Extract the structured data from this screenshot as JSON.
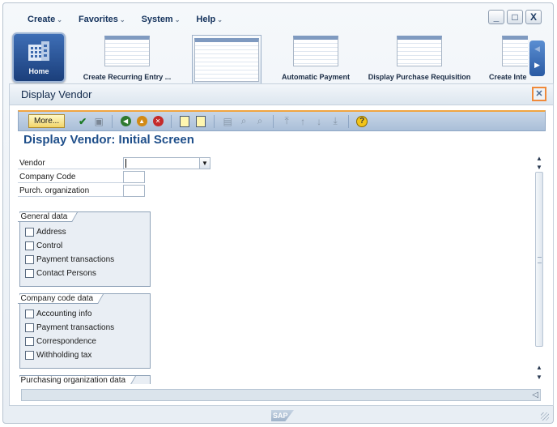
{
  "menu": [
    "Create",
    "Favorites",
    "System",
    "Help"
  ],
  "window_controls": {
    "minimize": "_",
    "maximize": "□",
    "close": "X"
  },
  "launchpad": {
    "home_label": "Home",
    "tiles": [
      "Create Recurring Entry ...",
      "",
      "Automatic Payment",
      "Display Purchase Requisition",
      "Create Inte"
    ]
  },
  "window": {
    "title": "Display Vendor",
    "close": "✕"
  },
  "toolbar": {
    "more_label": "More..."
  },
  "screen_title": "Display Vendor:  Initial Screen",
  "fields": {
    "vendor": {
      "label": "Vendor",
      "value": ""
    },
    "company_code": {
      "label": "Company Code",
      "value": ""
    },
    "purch_org": {
      "label": "Purch. organization",
      "value": ""
    }
  },
  "groups": {
    "general": {
      "title": "General data",
      "items": [
        "Address",
        "Control",
        "Payment transactions",
        "Contact Persons"
      ]
    },
    "company_code": {
      "title": "Company code data",
      "items": [
        "Accounting info",
        "Payment transactions",
        "Correspondence",
        "Withholding tax"
      ]
    },
    "purchasing": {
      "title": "Purchasing organization data"
    }
  },
  "footer": {
    "logo": "SAP"
  }
}
